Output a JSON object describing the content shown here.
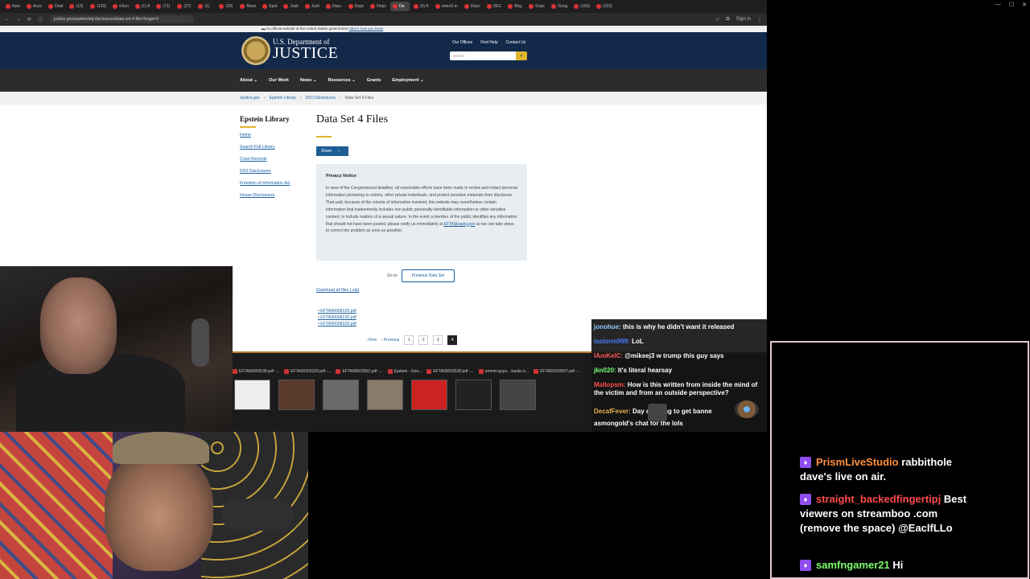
{
  "browser": {
    "tabs": [
      "New",
      "Acco",
      "Deal",
      "(12)",
      "(193)",
      "eSun",
      "(1) A",
      "(71)",
      "(27)",
      "(1)",
      "(30)",
      "Mass",
      "Epst",
      "Justi",
      "Justi",
      "Depc",
      "Depc",
      "Depc",
      "Da",
      "(6) A",
      "video2.m",
      "Depc",
      "OEC",
      "Bkg.",
      "Depc",
      "Goog",
      "(193)",
      "(193)"
    ],
    "active_tab_index": 18,
    "url": "justice.gov/epstein/doj-disclosures/data-set-4-files?page=3",
    "sign_in": "Sign in"
  },
  "site": {
    "gov_banner": "An official website of the United States government",
    "gov_banner_link": "Here's how you know",
    "dept_line": "U.S. Department of",
    "dept_name": "JUSTICE",
    "top_links": [
      "Our Offices",
      "Find Help",
      "Contact Us"
    ],
    "search_placeholder": "Search",
    "nav": [
      "About ⌄",
      "Our Work",
      "News ⌄",
      "Resources ⌄",
      "Grants",
      "Employment ⌄"
    ],
    "breadcrumb": [
      "Justice.gov",
      "Epstein Library",
      "DOJ Disclosures",
      "Data Set 4 Files"
    ],
    "sidebar_title": "Epstein Library",
    "sidebar_links": [
      "Home",
      "Search Full Library",
      "Court Records",
      "DOJ Disclosures",
      "Freedom of Information Act",
      "House Disclosures"
    ],
    "page_title": "Data Set 4 Files",
    "share_label": "Share",
    "privacy_title": "Privacy Notice",
    "privacy_body": "In view of the Congressional deadline, all reasonable efforts have been made to review and redact personal information pertaining to victims, other private individuals, and protect sensitive materials from disclosure. That said, because of the volume of information involved, this website may nevertheless contain information that inadvertently includes non-public personally identifiable information or other sensitive content, to include matters of a sexual nature. In the event a member of the public identifies any information that should not have been posted, please notify us immediately at",
    "privacy_email": "EFTA@usdoj.gov",
    "privacy_tail": "so we can take steps to correct the problem as soon as possible.",
    "goto_label": "Go to:",
    "prev_dataset": "Previous Data Set",
    "download_all": "Download all files (.zip)",
    "files": [
      "EFTA00008120.pdf",
      "EFTA00008220.pdf",
      "EFTA00008320.pdf"
    ],
    "pager": {
      "first": "‹ First",
      "previous": "‹ Previous",
      "pages": [
        "1",
        "2",
        "3",
        "4"
      ],
      "current": "4"
    }
  },
  "taskbar": {
    "thumb_tabs": [
      "EFTA00003538.pdf -...",
      "EFTA00003339.pdf -...",
      "EFTA00003552.pdf -...",
      "Epstein - Goo...",
      "EFTA00003538.pdf -...",
      "ummm guys... banks b...",
      "EFTA00003597.pdf -..."
    ]
  },
  "chat_overlay": [
    {
      "user": "jonohue:",
      "msg": "this is why he didn't want it released",
      "color": "#8ecbff"
    },
    {
      "user": "lastorm999:",
      "msg": "LoL",
      "color": "#4a7dff"
    },
    {
      "user": "IAmKelC:",
      "msg": "@mikeej3 w trump this guy says",
      "color": "#ff5a5a"
    },
    {
      "user": "jkn020:",
      "msg": "It's literal hearsay",
      "color": "#7bff7b"
    },
    {
      "user": "Mallopsm:",
      "msg": "How is this written from inside the mind of the victim and from an outside perspective?",
      "color": "#ff4f4f"
    },
    {
      "user": "DecafFever:",
      "msg": "Day      of trying to get banne",
      "color": "#e6b34a"
    },
    {
      "user": "",
      "msg": "asmongold's chat for the lols",
      "color": "#ffffff"
    }
  ],
  "chat_panel": [
    {
      "user": "PrismLiveStudio",
      "msg": "rabbithole dave's live on air.",
      "color": "#ff8f3d"
    },
    {
      "user": "straight_backedfingertipj",
      "msg": "Best viewers on streamboo .com (remove the space) @EaclfLLo",
      "color": "#ff4b4b"
    },
    {
      "user": "samfngamer21",
      "msg": "Hi",
      "color": "#7dff6e"
    }
  ]
}
